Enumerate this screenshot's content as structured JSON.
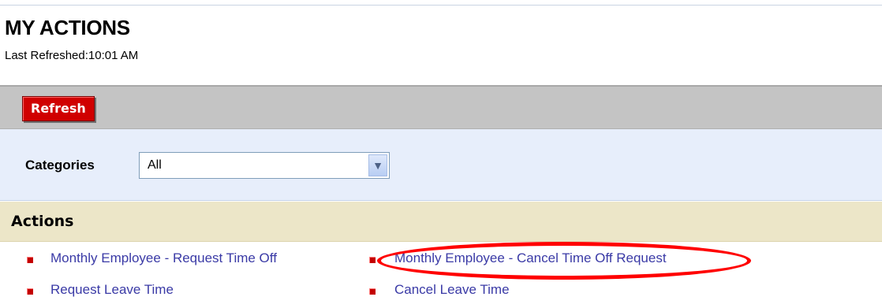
{
  "page": {
    "title": "MY ACTIONS",
    "last_refreshed": "Last Refreshed:10:01 AM"
  },
  "toolbar": {
    "refresh_label": "Refresh"
  },
  "filter": {
    "label": "Categories",
    "selected": "All"
  },
  "actions": {
    "header": "Actions",
    "items": [
      {
        "label": "Monthly Employee - Request Time Off"
      },
      {
        "label": "Monthly Employee - Cancel Time Off Request",
        "highlighted": true
      },
      {
        "label": "Request Leave Time"
      },
      {
        "label": "Cancel Leave Time"
      }
    ]
  },
  "colors": {
    "accent_red": "#d00000",
    "link_blue": "#3a3aa6",
    "annotation_red": "#ff0000"
  },
  "icons": {
    "dropdown": "chevron-down-icon",
    "bullet": "red-square-bullet-icon"
  }
}
